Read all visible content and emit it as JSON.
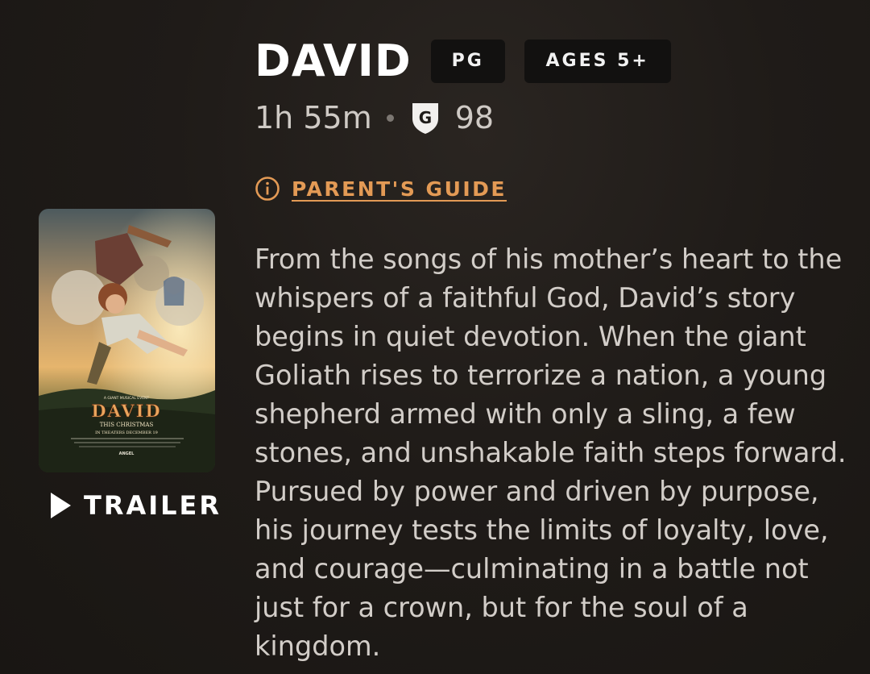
{
  "movie": {
    "title": "DAVID",
    "rating_badge": "PG",
    "ages_badge": "AGES 5+",
    "runtime": "1h 55m",
    "score_icon_letter": "G",
    "score": "98"
  },
  "links": {
    "parents_guide": "PARENT'S GUIDE"
  },
  "poster": {
    "tagline": "A GIANT MUSICAL EVENT",
    "logo": "DAVID",
    "subtitle": "THIS CHRISTMAS",
    "release": "IN THEATERS DECEMBER 19",
    "studio": "ANGEL"
  },
  "trailer": {
    "label": "TRAILER"
  },
  "synopsis": {
    "text": "From the songs of his mother’s heart to the whispers of a faithful God, David’s story begins in quiet devotion. When the giant Goliath rises to terrorize a nation, a young shepherd armed with only a sling, a few stones, and unshakable faith steps forward. Pursued by power and driven by purpose, his journey tests the limits of loyalty, love, and courage—culminating in a battle not just for a crown, but for the soul of a kingdom."
  },
  "colors": {
    "background": "#1f1b18",
    "accent_link": "#e39a55",
    "badge_bg": "#121110",
    "body_text": "#d2cdc8"
  },
  "icons": {
    "score": "shield-g-icon",
    "guide": "info-circle-icon",
    "trailer": "play-icon"
  }
}
